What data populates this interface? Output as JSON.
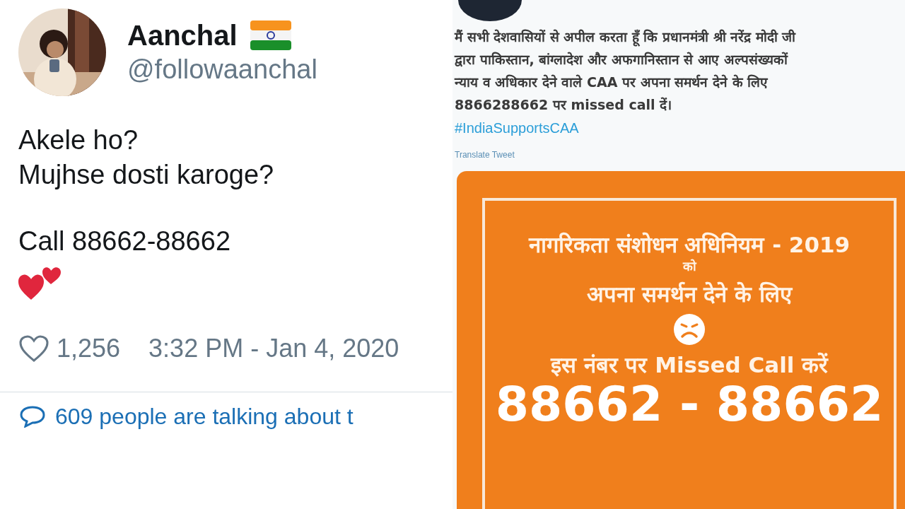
{
  "left_tweet": {
    "name": "Aanchal",
    "handle": "@followaanchal",
    "paragraphs": [
      [
        "Akele ho?",
        "Mujhse dosti karoge?"
      ],
      [
        "Call 88662-88662"
      ]
    ],
    "likes": "1,256",
    "timestamp": "3:32 PM - Jan 4, 2020",
    "conversation": "609 people are talking about t"
  },
  "right_tweet": {
    "text_lines": [
      "मैं सभी देशवासियों से अपील करता हूँ कि प्रधानमंत्री श्री नरेंद्र मोदी जी",
      "द्वारा पाकिस्तान, बांग्लादेश और अफगानिस्तान से आए अल्पसंख्यकों",
      "न्याय व अधिकार देने वाले CAA पर अपना समर्थन देने के लिए",
      "8866288662 पर missed call दें।"
    ],
    "hashtag": "#IndiaSupportsCAA",
    "translate": "Translate Tweet",
    "image_lines": [
      {
        "kind": "heading",
        "text": "नागरिकता संशोधन अधिनियम - 2019"
      },
      {
        "kind": "small",
        "text": "को"
      },
      {
        "kind": "heading",
        "text": "अपना समर्थन देने के लिए"
      },
      {
        "kind": "face"
      },
      {
        "kind": "heading",
        "text": "इस नंबर पर Missed Call करें"
      },
      {
        "kind": "number",
        "text": "88662 - 88662"
      }
    ]
  }
}
